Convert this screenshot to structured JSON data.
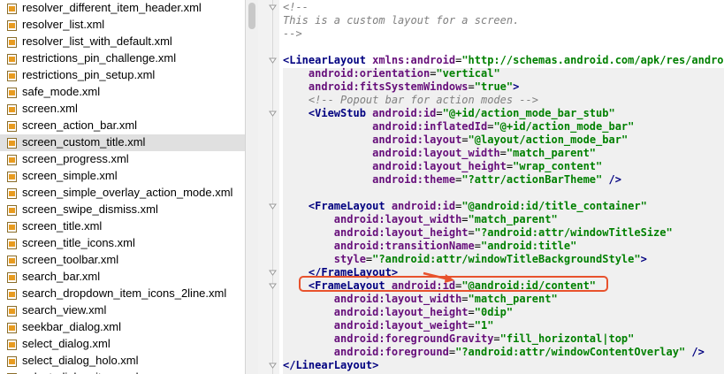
{
  "files": [
    {
      "name": "resolver_different_item_header.xml",
      "icon": "xml-file-icon"
    },
    {
      "name": "resolver_list.xml",
      "icon": "xml-file-icon"
    },
    {
      "name": "resolver_list_with_default.xml",
      "icon": "xml-file-icon"
    },
    {
      "name": "restrictions_pin_challenge.xml",
      "icon": "xml-file-icon"
    },
    {
      "name": "restrictions_pin_setup.xml",
      "icon": "xml-file-icon"
    },
    {
      "name": "safe_mode.xml",
      "icon": "xml-file-icon"
    },
    {
      "name": "screen.xml",
      "icon": "xml-file-icon"
    },
    {
      "name": "screen_action_bar.xml",
      "icon": "xml-file-icon"
    },
    {
      "name": "screen_custom_title.xml",
      "icon": "xml-file-icon",
      "selected": true
    },
    {
      "name": "screen_progress.xml",
      "icon": "xml-file-icon"
    },
    {
      "name": "screen_simple.xml",
      "icon": "xml-file-icon"
    },
    {
      "name": "screen_simple_overlay_action_mode.xml",
      "icon": "xml-file-icon"
    },
    {
      "name": "screen_swipe_dismiss.xml",
      "icon": "xml-file-icon"
    },
    {
      "name": "screen_title.xml",
      "icon": "xml-file-icon"
    },
    {
      "name": "screen_title_icons.xml",
      "icon": "xml-file-icon"
    },
    {
      "name": "screen_toolbar.xml",
      "icon": "xml-file-icon"
    },
    {
      "name": "search_bar.xml",
      "icon": "xml-file-icon"
    },
    {
      "name": "search_dropdown_item_icons_2line.xml",
      "icon": "xml-file-icon"
    },
    {
      "name": "search_view.xml",
      "icon": "xml-file-icon"
    },
    {
      "name": "seekbar_dialog.xml",
      "icon": "xml-file-icon"
    },
    {
      "name": "select_dialog.xml",
      "icon": "xml-file-icon"
    },
    {
      "name": "select_dialog_holo.xml",
      "icon": "xml-file-icon"
    },
    {
      "name": "select_dialog_item.xml",
      "icon": "xml-file-icon"
    }
  ],
  "code_lines": [
    [
      {
        "t": "<!--",
        "c": "cmt"
      }
    ],
    [
      {
        "t": "This is a custom layout for a screen.",
        "c": "cmt"
      }
    ],
    [
      {
        "t": "-->",
        "c": "cmt"
      }
    ],
    [],
    [
      {
        "t": "<LinearLayout ",
        "c": "tag"
      },
      {
        "t": "xmlns:android",
        "c": "attr"
      },
      {
        "t": "=",
        "c": "pun"
      },
      {
        "t": "\"http://schemas.android.com/apk/res/android\"",
        "c": "val"
      }
    ],
    [
      {
        "t": "    "
      },
      {
        "t": "android:orientation",
        "c": "attr"
      },
      {
        "t": "=",
        "c": "pun"
      },
      {
        "t": "\"vertical\"",
        "c": "val"
      }
    ],
    [
      {
        "t": "    "
      },
      {
        "t": "android:fitsSystemWindows",
        "c": "attr"
      },
      {
        "t": "=",
        "c": "pun"
      },
      {
        "t": "\"true\"",
        "c": "val"
      },
      {
        "t": ">",
        "c": "tag"
      }
    ],
    [
      {
        "t": "    "
      },
      {
        "t": "<!-- Popout bar for action modes -->",
        "c": "cmt"
      }
    ],
    [
      {
        "t": "    "
      },
      {
        "t": "<ViewStub ",
        "c": "tag"
      },
      {
        "t": "android:id",
        "c": "attr"
      },
      {
        "t": "=",
        "c": "pun"
      },
      {
        "t": "\"@+id/action_mode_bar_stub\"",
        "c": "val"
      }
    ],
    [
      {
        "t": "              "
      },
      {
        "t": "android:inflatedId",
        "c": "attr"
      },
      {
        "t": "=",
        "c": "pun"
      },
      {
        "t": "\"@+id/action_mode_bar\"",
        "c": "val"
      }
    ],
    [
      {
        "t": "              "
      },
      {
        "t": "android:layout",
        "c": "attr"
      },
      {
        "t": "=",
        "c": "pun"
      },
      {
        "t": "\"@layout/action_mode_bar\"",
        "c": "val"
      }
    ],
    [
      {
        "t": "              "
      },
      {
        "t": "android:layout_width",
        "c": "attr"
      },
      {
        "t": "=",
        "c": "pun"
      },
      {
        "t": "\"match_parent\"",
        "c": "val"
      }
    ],
    [
      {
        "t": "              "
      },
      {
        "t": "android:layout_height",
        "c": "attr"
      },
      {
        "t": "=",
        "c": "pun"
      },
      {
        "t": "\"wrap_content\"",
        "c": "val"
      }
    ],
    [
      {
        "t": "              "
      },
      {
        "t": "android:theme",
        "c": "attr"
      },
      {
        "t": "=",
        "c": "pun"
      },
      {
        "t": "\"?attr/actionBarTheme\"",
        "c": "val"
      },
      {
        "t": " />",
        "c": "tag"
      }
    ],
    [],
    [
      {
        "t": "    "
      },
      {
        "t": "<FrameLayout ",
        "c": "tag"
      },
      {
        "t": "android:id",
        "c": "attr"
      },
      {
        "t": "=",
        "c": "pun"
      },
      {
        "t": "\"@android:id/title_container\"",
        "c": "val"
      }
    ],
    [
      {
        "t": "        "
      },
      {
        "t": "android:layout_width",
        "c": "attr"
      },
      {
        "t": "=",
        "c": "pun"
      },
      {
        "t": "\"match_parent\"",
        "c": "val"
      }
    ],
    [
      {
        "t": "        "
      },
      {
        "t": "android:layout_height",
        "c": "attr"
      },
      {
        "t": "=",
        "c": "pun"
      },
      {
        "t": "\"?android:attr/windowTitleSize\"",
        "c": "val"
      }
    ],
    [
      {
        "t": "        "
      },
      {
        "t": "android:transitionName",
        "c": "attr"
      },
      {
        "t": "=",
        "c": "pun"
      },
      {
        "t": "\"android:title\"",
        "c": "val"
      }
    ],
    [
      {
        "t": "        "
      },
      {
        "t": "style",
        "c": "attr"
      },
      {
        "t": "=",
        "c": "pun"
      },
      {
        "t": "\"?android:attr/windowTitleBackgroundStyle\"",
        "c": "val"
      },
      {
        "t": ">",
        "c": "tag"
      }
    ],
    [
      {
        "t": "    "
      },
      {
        "t": "</FrameLayout>",
        "c": "tag"
      }
    ],
    [
      {
        "t": "    "
      },
      {
        "t": "<FrameLayout ",
        "c": "tag"
      },
      {
        "t": "android:id",
        "c": "attr"
      },
      {
        "t": "=",
        "c": "pun"
      },
      {
        "t": "\"@android:id/content\"",
        "c": "val"
      }
    ],
    [
      {
        "t": "        "
      },
      {
        "t": "android:layout_width",
        "c": "attr"
      },
      {
        "t": "=",
        "c": "pun"
      },
      {
        "t": "\"match_parent\"",
        "c": "val"
      }
    ],
    [
      {
        "t": "        "
      },
      {
        "t": "android:layout_height",
        "c": "attr"
      },
      {
        "t": "=",
        "c": "pun"
      },
      {
        "t": "\"0dip\"",
        "c": "val"
      }
    ],
    [
      {
        "t": "        "
      },
      {
        "t": "android:layout_weight",
        "c": "attr"
      },
      {
        "t": "=",
        "c": "pun"
      },
      {
        "t": "\"1\"",
        "c": "val"
      }
    ],
    [
      {
        "t": "        "
      },
      {
        "t": "android:foregroundGravity",
        "c": "attr"
      },
      {
        "t": "=",
        "c": "pun"
      },
      {
        "t": "\"fill_horizontal|top\"",
        "c": "val"
      }
    ],
    [
      {
        "t": "        "
      },
      {
        "t": "android:foreground",
        "c": "attr"
      },
      {
        "t": "=",
        "c": "pun"
      },
      {
        "t": "\"?android:attr/windowContentOverlay\"",
        "c": "val"
      },
      {
        "t": " />",
        "c": "tag"
      }
    ],
    [
      {
        "t": "</LinearLayout>",
        "c": "tag"
      }
    ]
  ],
  "colors": {
    "highlight_box": "#e8522d",
    "selected_row": "#e0e0e0"
  }
}
